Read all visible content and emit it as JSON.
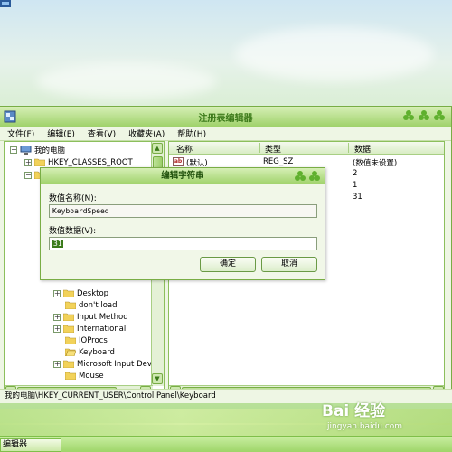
{
  "window": {
    "title": "注册表编辑器"
  },
  "menu": [
    {
      "label": "文件(F)"
    },
    {
      "label": "编辑(E)"
    },
    {
      "label": "查看(V)"
    },
    {
      "label": "收藏夹(A)"
    },
    {
      "label": "帮助(H)"
    }
  ],
  "tree": {
    "root": "我的电脑",
    "classes_root": "HKEY_CLASSES_ROOT",
    "items": [
      "Desktop",
      "don't load",
      "Input Method",
      "International",
      "IOProcs",
      "Keyboard",
      "Microsoft Input Devi",
      "Mouse"
    ]
  },
  "values_pane": {
    "headers": {
      "name": "名称",
      "type": "类型",
      "data": "数据"
    },
    "rows": [
      {
        "icon": "ab",
        "name": "(默认)",
        "type": "REG_SZ",
        "data": "(数值未设置)"
      },
      {
        "data": "2"
      },
      {
        "data": "1"
      },
      {
        "data": "31"
      }
    ]
  },
  "dialog": {
    "title": "编辑字符串",
    "name_label": "数值名称(N):",
    "name_value": "KeyboardSpeed",
    "data_label": "数值数据(V):",
    "data_value": "31",
    "ok_label": "确定",
    "cancel_label": "取消"
  },
  "statusbar": {
    "path": "我的电脑\\HKEY_CURRENT_USER\\Control Panel\\Keyboard"
  },
  "taskbar": {
    "item_label": "编辑器"
  },
  "watermark": {
    "logo_text": "Bai 经验",
    "url": "jingyan.baidu.com"
  },
  "colors": {
    "accent": "#9fd26a",
    "border": "#79ad45",
    "title_text": "#3c7a1a",
    "selection": "#3a7a1a"
  }
}
